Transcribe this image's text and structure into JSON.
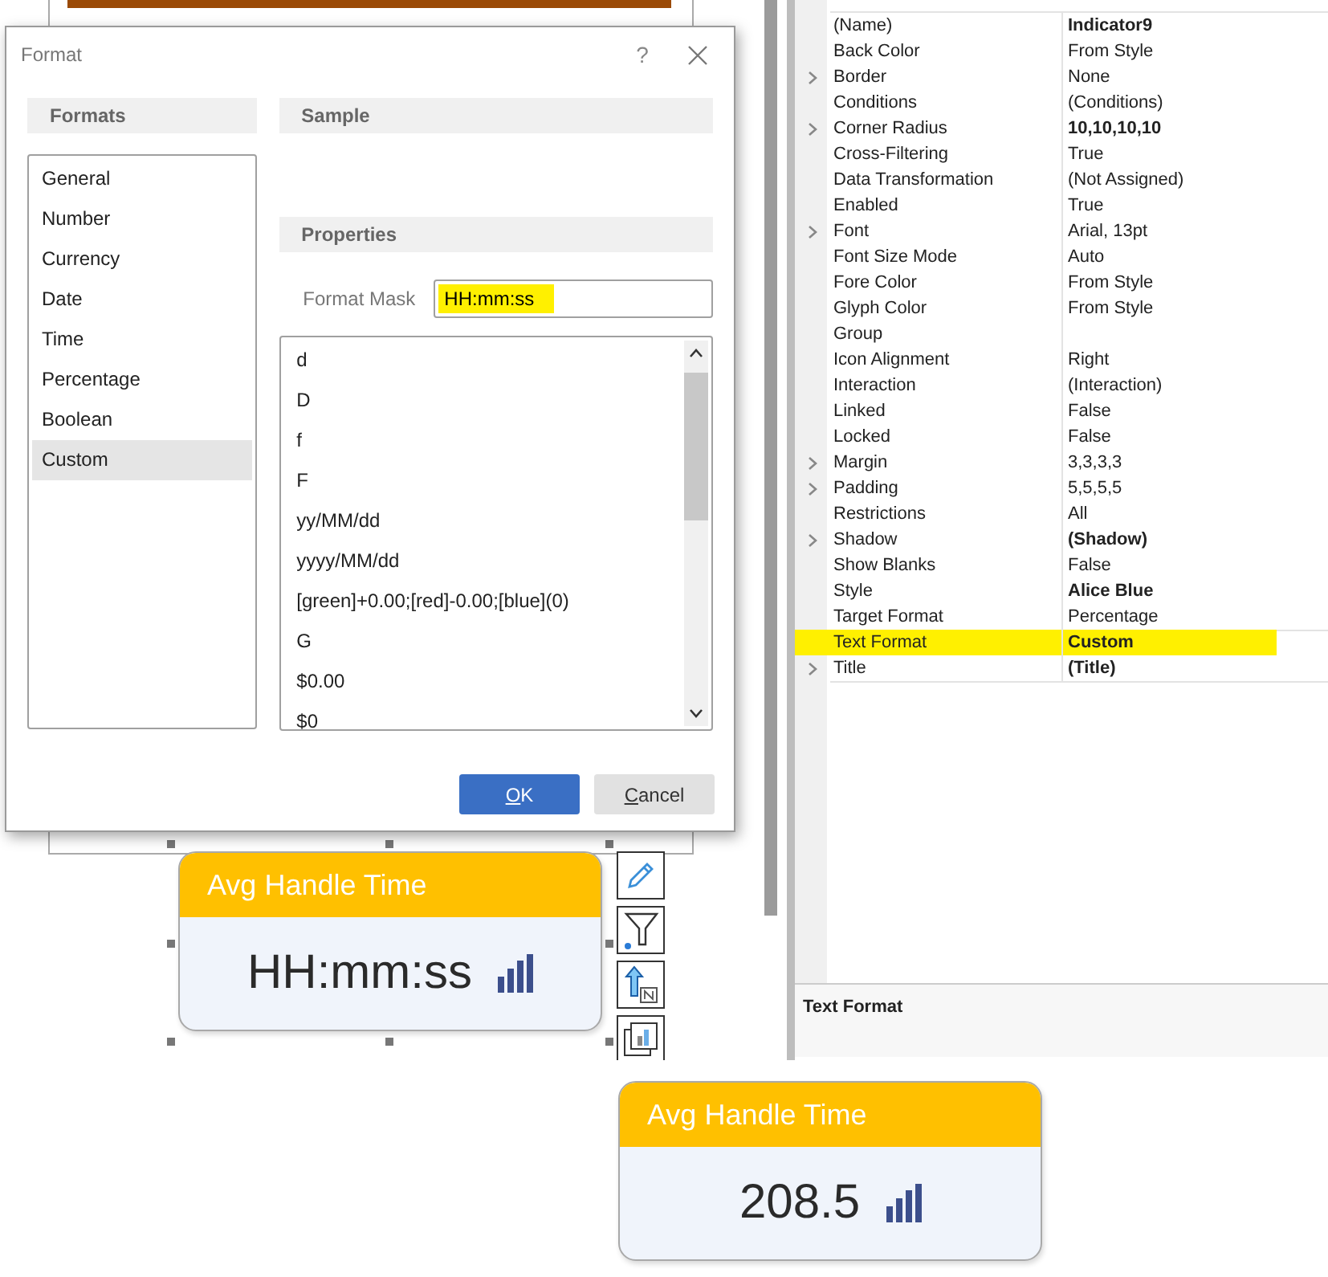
{
  "dialog": {
    "title": "Format",
    "help": "?",
    "formats_header": "Formats",
    "formats": [
      {
        "label": "General",
        "selected": false
      },
      {
        "label": "Number",
        "selected": false
      },
      {
        "label": "Currency",
        "selected": false
      },
      {
        "label": "Date",
        "selected": false
      },
      {
        "label": "Time",
        "selected": false
      },
      {
        "label": "Percentage",
        "selected": false
      },
      {
        "label": "Boolean",
        "selected": false
      },
      {
        "label": "Custom",
        "selected": true
      }
    ],
    "sample_header": "Sample",
    "properties_header": "Properties",
    "format_mask": {
      "label": "Format Mask",
      "value": "HH:mm:ss",
      "highlighted": true
    },
    "masks": [
      "d",
      "D",
      "f",
      "F",
      "yy/MM/dd",
      "yyyy/MM/dd",
      "[green]+0.00;[red]-0.00;[blue](0)",
      "G",
      "$0.00",
      "$0"
    ],
    "buttons": [
      {
        "label": "OK",
        "primary": true
      },
      {
        "label": "Cancel",
        "primary": false
      }
    ]
  },
  "designer_indicator": {
    "title": "Avg Handle Time",
    "value": "HH:mm:ss",
    "selected": true
  },
  "property_grid": {
    "rows": [
      {
        "name": "(Name)",
        "value": "Indicator9",
        "expandable": false,
        "bold": true,
        "highlighted": false
      },
      {
        "name": "Back Color",
        "value": "From Style",
        "expandable": false,
        "bold": false,
        "highlighted": false
      },
      {
        "name": "Border",
        "value": "None",
        "expandable": true,
        "bold": false,
        "highlighted": false
      },
      {
        "name": "Conditions",
        "value": "(Conditions)",
        "expandable": false,
        "bold": false,
        "highlighted": false
      },
      {
        "name": "Corner Radius",
        "value": "10,10,10,10",
        "expandable": true,
        "bold": true,
        "highlighted": false
      },
      {
        "name": "Cross-Filtering",
        "value": "True",
        "expandable": false,
        "bold": false,
        "highlighted": false
      },
      {
        "name": "Data Transformation",
        "value": "(Not Assigned)",
        "expandable": false,
        "bold": false,
        "highlighted": false
      },
      {
        "name": "Enabled",
        "value": "True",
        "expandable": false,
        "bold": false,
        "highlighted": false
      },
      {
        "name": "Font",
        "value": "Arial, 13pt",
        "expandable": true,
        "bold": false,
        "highlighted": false
      },
      {
        "name": "Font Size Mode",
        "value": "Auto",
        "expandable": false,
        "bold": false,
        "highlighted": false
      },
      {
        "name": "Fore Color",
        "value": "From Style",
        "expandable": false,
        "bold": false,
        "highlighted": false
      },
      {
        "name": "Glyph Color",
        "value": "From Style",
        "expandable": false,
        "bold": false,
        "highlighted": false
      },
      {
        "name": "Group",
        "expandable": false,
        "highlighted": false
      },
      {
        "name": "Icon Alignment",
        "value": "Right",
        "expandable": false,
        "bold": false,
        "highlighted": false
      },
      {
        "name": "Interaction",
        "value": "(Interaction)",
        "expandable": false,
        "bold": false,
        "highlighted": false
      },
      {
        "name": "Linked",
        "value": "False",
        "expandable": false,
        "bold": false,
        "highlighted": false
      },
      {
        "name": "Locked",
        "value": "False",
        "expandable": false,
        "bold": false,
        "highlighted": false
      },
      {
        "name": "Margin",
        "value": "3,3,3,3",
        "expandable": true,
        "bold": false,
        "highlighted": false
      },
      {
        "name": "Padding",
        "value": "5,5,5,5",
        "expandable": true,
        "bold": false,
        "highlighted": false
      },
      {
        "name": "Restrictions",
        "value": "All",
        "expandable": false,
        "bold": false,
        "highlighted": false
      },
      {
        "name": "Shadow",
        "value": "(Shadow)",
        "expandable": true,
        "bold": true,
        "highlighted": false
      },
      {
        "name": "Show Blanks",
        "value": "False",
        "expandable": false,
        "bold": false,
        "highlighted": false
      },
      {
        "name": "Style",
        "value": "Alice Blue",
        "expandable": false,
        "bold": true,
        "highlighted": false
      },
      {
        "name": "Target Format",
        "value": "Percentage",
        "expandable": false,
        "bold": false,
        "highlighted": false
      },
      {
        "name": "Text Format",
        "value": "Custom",
        "expandable": false,
        "bold": true,
        "highlighted": true
      },
      {
        "name": "Title",
        "value": "(Title)",
        "expandable": true,
        "bold": true,
        "highlighted": false
      }
    ],
    "description": "Text Format"
  },
  "preview_indicator": {
    "title": "Avg Handle Time",
    "value": "208.5"
  }
}
